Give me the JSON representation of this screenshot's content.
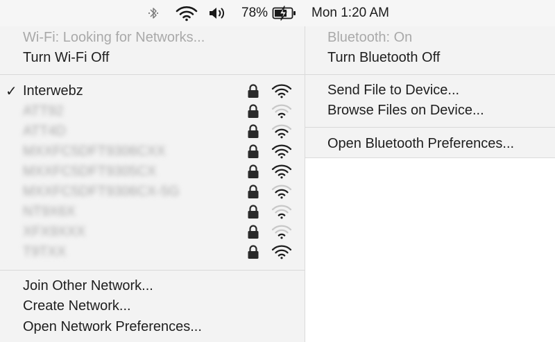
{
  "menubar": {
    "bluetooth_icon": "bluetooth-icon",
    "wifi_icon": "wifi-icon",
    "volume_icon": "volume-icon",
    "battery_percent": "78%",
    "battery_icon": "battery-charging-icon",
    "clock": "Mon 1:20 AM"
  },
  "wifi_menu": {
    "status": "Wi-Fi: Looking for Networks...",
    "toggle": "Turn Wi-Fi Off",
    "networks": [
      {
        "name": "Interwebz",
        "connected": true,
        "locked": true,
        "bars": 3,
        "redacted": false
      },
      {
        "name": "ATT92",
        "connected": false,
        "locked": true,
        "bars": 1,
        "redacted": true
      },
      {
        "name": "ATT4D",
        "connected": false,
        "locked": true,
        "bars": 2,
        "redacted": true
      },
      {
        "name": "MXXFC5DFT9306CXX",
        "connected": false,
        "locked": true,
        "bars": 3,
        "redacted": true
      },
      {
        "name": "MXXFC5DFT9305CX",
        "connected": false,
        "locked": true,
        "bars": 3,
        "redacted": true
      },
      {
        "name": "MXXFC5DFT9306CX-5G",
        "connected": false,
        "locked": true,
        "bars": 2,
        "redacted": true
      },
      {
        "name": "NT9X6X",
        "connected": false,
        "locked": true,
        "bars": 1,
        "redacted": true
      },
      {
        "name": "XFX9XXX",
        "connected": false,
        "locked": true,
        "bars": 1,
        "redacted": true
      },
      {
        "name": "T9TXX",
        "connected": false,
        "locked": true,
        "bars": 3,
        "redacted": true
      }
    ],
    "join_other": "Join Other Network...",
    "create": "Create Network...",
    "open_prefs": "Open Network Preferences..."
  },
  "bluetooth_menu": {
    "status": "Bluetooth: On",
    "toggle": "Turn Bluetooth Off",
    "send_file": "Send File to Device...",
    "browse_files": "Browse Files on Device...",
    "open_prefs": "Open Bluetooth Preferences..."
  },
  "colors": {
    "menu_bg": "#f3f3f3",
    "disabled_text": "#a9a9a9",
    "signal_active": "#1e1e1e",
    "signal_inactive": "#c8c8c8"
  }
}
